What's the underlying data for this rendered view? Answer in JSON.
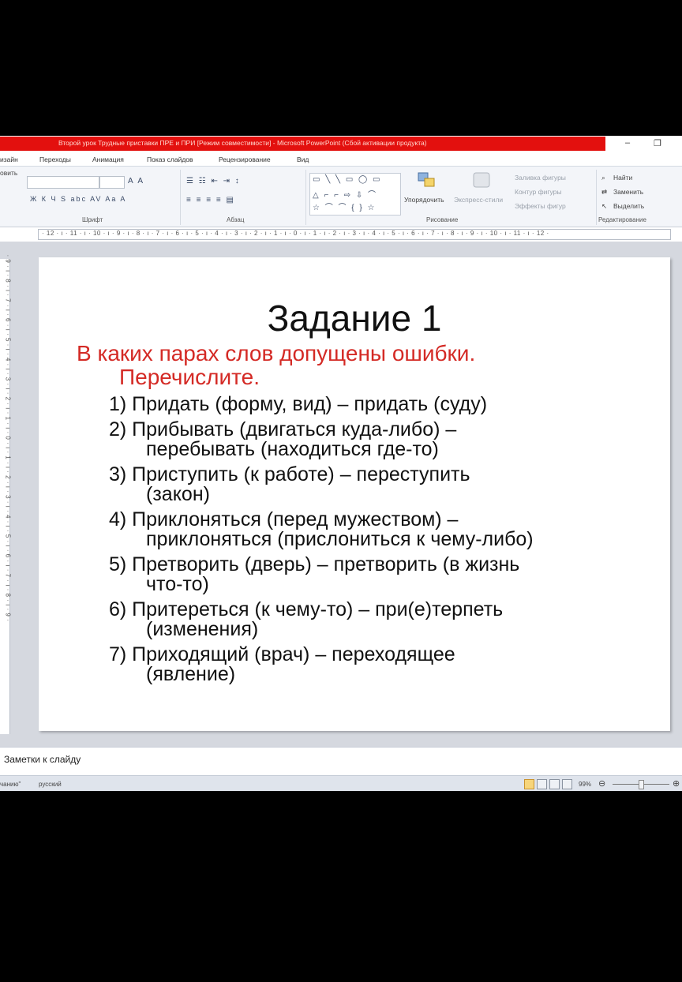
{
  "window": {
    "title": "Второй урок Трудные приставки ПРЕ и ПРИ [Режим совместимости] - Microsoft PowerPoint (Сбой активации продукта)",
    "minimize": "–",
    "restore": "❐"
  },
  "tabs": [
    "изайн",
    "Переходы",
    "Анимация",
    "Показ слайдов",
    "Рецензирование",
    "Вид"
  ],
  "ribbon": {
    "paste_partial": "овить",
    "font_group": "Шрифт",
    "paragraph_group": "Абзац",
    "drawing_group": "Рисование",
    "editing_group": "Редактирование",
    "arrange": "Упорядочить",
    "quick_styles": "Экспресс-стили",
    "shape_fill": "Заливка фигуры",
    "shape_outline": "Контур фигуры",
    "shape_effects": "Эффекты фигур",
    "find": "Найти",
    "replace": "Заменить",
    "select": "Выделить",
    "font_buttons": "Ж К Ч S abc AV Aa A",
    "grow_shrink": "A A"
  },
  "ruler": {
    "horizontal": "· 12 · ı · 11 · ı · 10 · ı · 9 · ı · 8 · ı · 7 · ı · 6 · ı · 5 · ı · 4 · ı · 3 · ı · 2 · ı · 1 · ı · 0 · ı · 1 · ı · 2 · ı · 3 · ı · 4 · ı · 5 · ı · 6 · ı · 7 · ı · 8 · ı · 9 · ı · 10 · ı · 11 · ı · 12 ·",
    "vertical": "· 9 · ı · 8 · ı · 7 · ı · 6 · ı · 5 · ı · 4 · ı · 3 · ı · 2 · ı · 1 · ı · 0 · ı · 1 · ı · 2 · ı · 3 · ı · 4 · ı · 5 · ı · 6 · ı · 7 · ı · 8 · ı · 9 ·"
  },
  "slide": {
    "title": "Задание 1",
    "question_line1": "В каких парах слов допущены ошибки.",
    "question_line2": "Перечислите.",
    "items": [
      {
        "line1": "1) Придать (форму, вид) – придать (суду)",
        "line2": ""
      },
      {
        "line1": "2) Прибывать (двигаться куда-либо) –",
        "line2": "перебывать (находиться где-то)"
      },
      {
        "line1": "3) Приступить (к работе) – переступить",
        "line2": "(закон)"
      },
      {
        "line1": "4) Приклоняться (перед мужеством) –",
        "line2": "приклоняться (прислониться к чему-либо)"
      },
      {
        "line1": "5) Претворить (дверь) – претворить (в жизнь",
        "line2": "что-то)"
      },
      {
        "line1": "6) Притереться (к чему-то) – при(е)терпеть",
        "line2": "(изменения)"
      },
      {
        "line1": "7) Приходящий (врач) – переходящее",
        "line2": "(явление)"
      }
    ]
  },
  "notes": {
    "placeholder": "Заметки к слайду"
  },
  "status": {
    "left_partial": "чанию\"",
    "language": "русский",
    "zoom": "99%"
  },
  "colors": {
    "title_bar": "#e3100e",
    "question_text": "#d42a25"
  }
}
